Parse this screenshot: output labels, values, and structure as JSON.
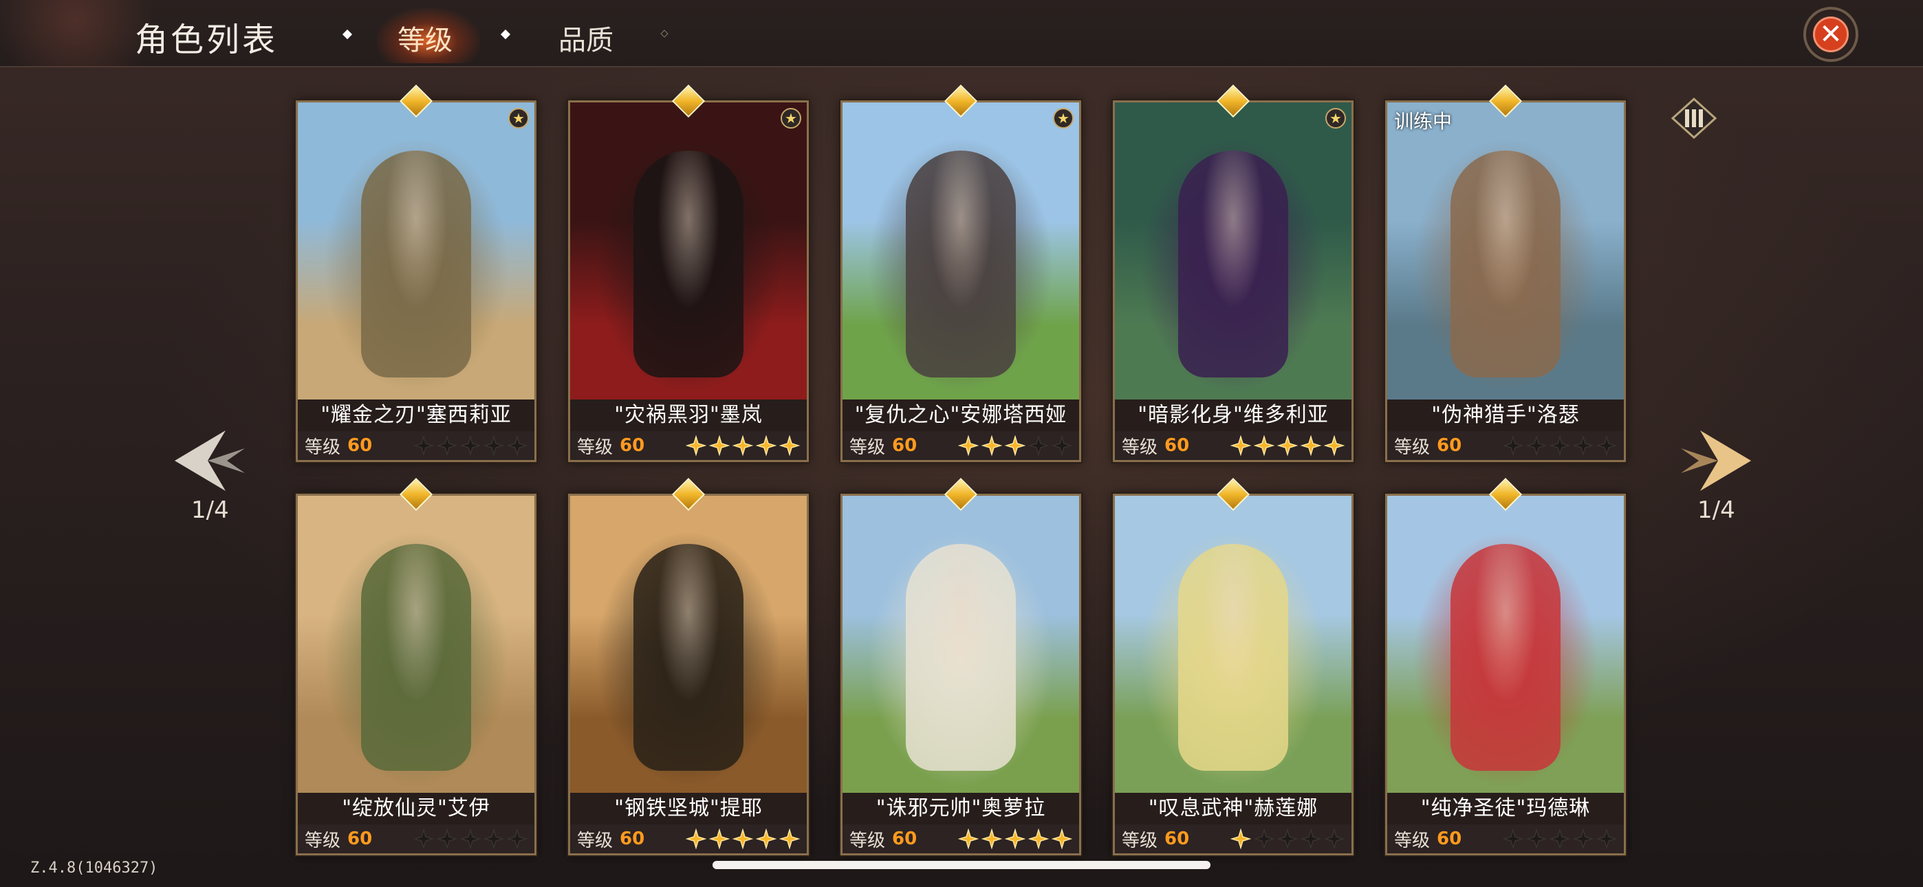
{
  "header": {
    "title": "角色列表",
    "tabs": [
      {
        "label": "等级",
        "active": true
      },
      {
        "label": "品质",
        "active": false
      }
    ],
    "close_icon": "close-icon"
  },
  "filter_icon": "filter-icon",
  "pagination": {
    "left": "1/4",
    "right": "1/4"
  },
  "colors": {
    "accent": "#ff9a1f",
    "close_red": "#d6401e",
    "star_gold": "#f7b52a",
    "gem_gold": "#f1b62a"
  },
  "level_label": "等级",
  "characters": [
    {
      "name": "\"耀金之刃\"塞西莉亚",
      "level": "60",
      "stars": 0,
      "favorite": true,
      "badge": "",
      "palette": [
        "#8fb9d9",
        "#c8a876",
        "#7a6a48"
      ]
    },
    {
      "name": "\"灾祸黑羽\"墨岚",
      "level": "60",
      "stars": 5,
      "favorite": true,
      "badge": "",
      "palette": [
        "#3a1414",
        "#8e1c1c",
        "#1c1414"
      ]
    },
    {
      "name": "\"复仇之心\"安娜塔西娅",
      "level": "60",
      "stars": 3,
      "favorite": true,
      "badge": "",
      "palette": [
        "#9cc4e6",
        "#6fa34a",
        "#4a4040"
      ]
    },
    {
      "name": "\"暗影化身\"维多利亚",
      "level": "60",
      "stars": 5,
      "favorite": true,
      "badge": "",
      "palette": [
        "#2f5a4a",
        "#4e7a52",
        "#3a2050"
      ]
    },
    {
      "name": "\"伪神猎手\"洛瑟",
      "level": "60",
      "stars": 0,
      "favorite": false,
      "badge": "训练中",
      "palette": [
        "#8ab0cc",
        "#5a7a8a",
        "#8a6a4e"
      ]
    },
    {
      "name": "\"绽放仙灵\"艾伊",
      "level": "60",
      "stars": 0,
      "favorite": false,
      "badge": "",
      "palette": [
        "#d8b482",
        "#b08a58",
        "#5a6a3a"
      ]
    },
    {
      "name": "\"钢铁坚城\"提耶",
      "level": "60",
      "stars": 5,
      "favorite": false,
      "badge": "",
      "palette": [
        "#d6a66a",
        "#8a5a2a",
        "#2a2218"
      ]
    },
    {
      "name": "\"诛邪元帅\"奥萝拉",
      "level": "60",
      "stars": 5,
      "favorite": false,
      "badge": "",
      "palette": [
        "#9cc0de",
        "#7aa04e",
        "#e8e2d2"
      ]
    },
    {
      "name": "\"叹息武神\"赫莲娜",
      "level": "60",
      "stars": 1,
      "favorite": false,
      "badge": "",
      "palette": [
        "#a6c8e2",
        "#7aa058",
        "#e6d88a"
      ]
    },
    {
      "name": "\"纯净圣徒\"玛德琳",
      "level": "60",
      "stars": 0,
      "favorite": false,
      "badge": "",
      "palette": [
        "#a4c6e4",
        "#7fa056",
        "#c8363a"
      ]
    }
  ],
  "version": "Z.4.8(1046327)"
}
